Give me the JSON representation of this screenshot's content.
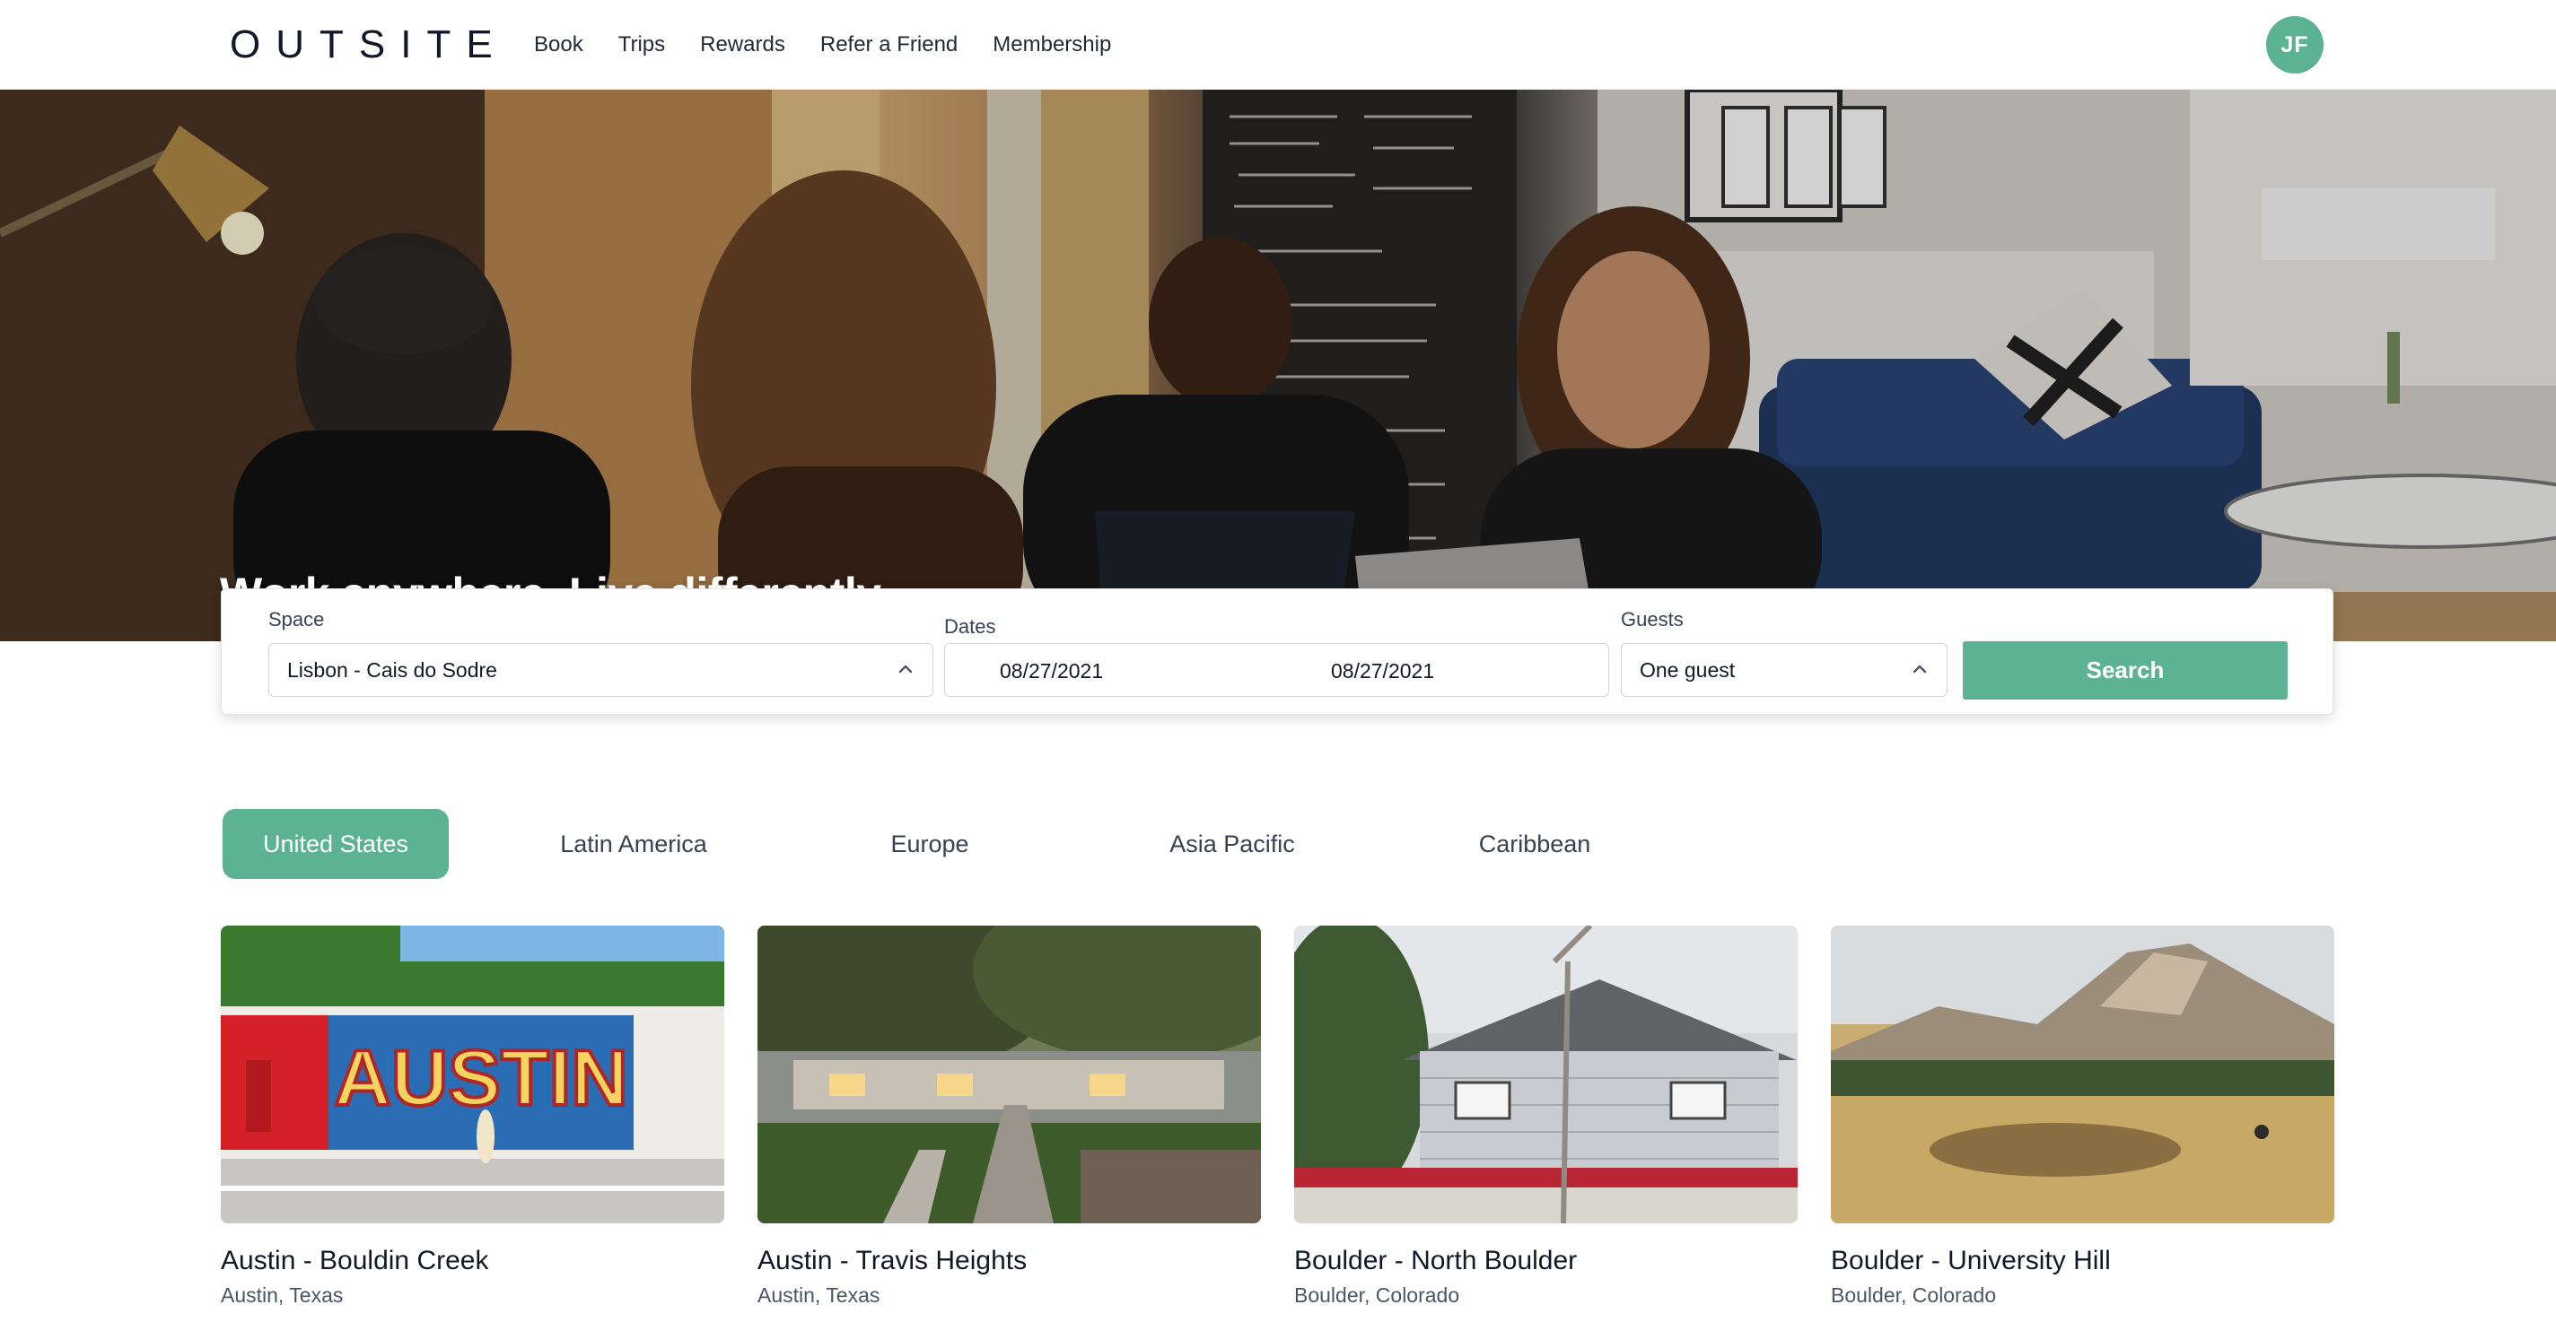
{
  "brand": {
    "logo": "OUTSITE",
    "accent_color": "#5cb393"
  },
  "nav": {
    "items": [
      {
        "label": "Book"
      },
      {
        "label": "Trips"
      },
      {
        "label": "Rewards"
      },
      {
        "label": "Refer a Friend"
      },
      {
        "label": "Membership"
      }
    ],
    "avatar_initials": "JF"
  },
  "hero": {
    "title": "Work anywhere. Live differently."
  },
  "search": {
    "space_label": "Space",
    "space_value": "Lisbon - Cais do Sodre",
    "dates_label": "Dates",
    "check_in": "08/27/2021",
    "check_out": "08/27/2021",
    "guests_label": "Guests",
    "guests_value": "One guest",
    "button_label": "Search"
  },
  "regions": {
    "selected": "United States",
    "tabs": [
      {
        "label": "United States"
      },
      {
        "label": "Latin America"
      },
      {
        "label": "Europe"
      },
      {
        "label": "Asia Pacific"
      },
      {
        "label": "Caribbean"
      }
    ]
  },
  "listings": [
    {
      "name": "Austin - Bouldin Creek",
      "location": "Austin, Texas"
    },
    {
      "name": "Austin - Travis Heights",
      "location": "Austin, Texas"
    },
    {
      "name": "Boulder - North Boulder",
      "location": "Boulder, Colorado"
    },
    {
      "name": "Boulder - University Hill",
      "location": "Boulder, Colorado"
    }
  ]
}
